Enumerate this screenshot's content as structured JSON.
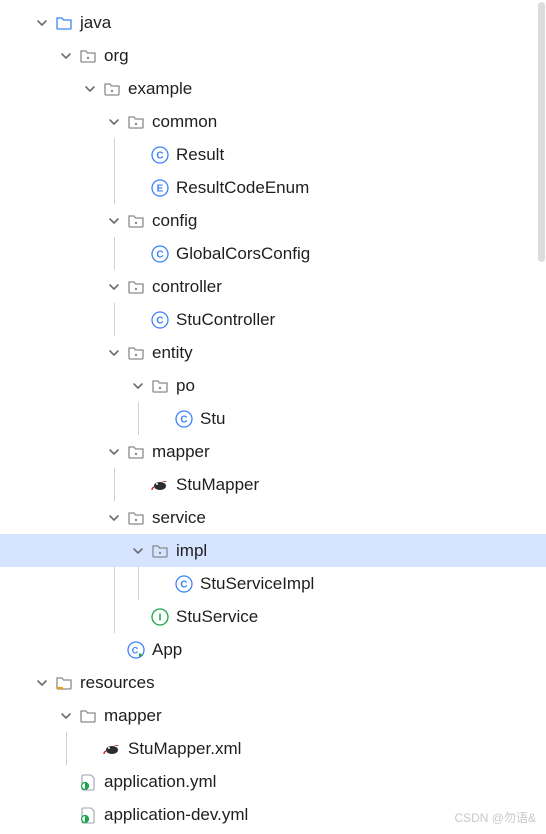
{
  "tree": {
    "java": "java",
    "org": "org",
    "example": "example",
    "common": "common",
    "result": "Result",
    "resultCodeEnum": "ResultCodeEnum",
    "config": "config",
    "globalCorsConfig": "GlobalCorsConfig",
    "controller": "controller",
    "stuController": "StuController",
    "entity": "entity",
    "po": "po",
    "stu": "Stu",
    "mapper": "mapper",
    "stuMapper": "StuMapper",
    "service": "service",
    "impl": "impl",
    "stuServiceImpl": "StuServiceImpl",
    "stuService": "StuService",
    "app": "App",
    "resources": "resources",
    "mapperFolder": "mapper",
    "stuMapperXml": "StuMapper.xml",
    "applicationYml": "application.yml",
    "applicationDevYml": "application-dev.yml"
  },
  "watermark": "CSDN @勿语&"
}
